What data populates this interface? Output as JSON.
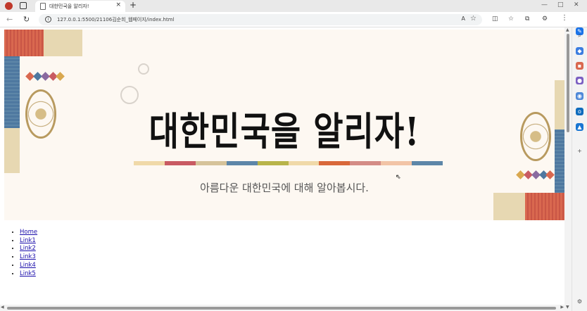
{
  "browser": {
    "tab_title": "대한민국을 알리자!",
    "tab_close": "×",
    "new_tab": "+",
    "url": "127.0.0.1:5500/21106김순희_웹페이지/index.html",
    "minimize": "—",
    "maximize": "□",
    "close": "✕",
    "more": "⋮"
  },
  "banner": {
    "title": "대한민국을 알리자!",
    "subtitle": "아름다운 대한민국에 대해 알아봅시다.",
    "stripe_colors": [
      "#f0d9a8",
      "#c95b63",
      "#d6c39a",
      "#5d86a8",
      "#b8b44a",
      "#f0d9a8",
      "#d9683a",
      "#d48c86",
      "#f2c4a6",
      "#5d86a8"
    ],
    "accent_colors": {
      "red": "#d9684f",
      "blue": "#4e78a0",
      "beige": "#e7d8b2",
      "gold": "#b89a5f"
    }
  },
  "nav": {
    "links": [
      "Home",
      "Link1",
      "Link2",
      "Link3",
      "Link4",
      "Link5"
    ]
  }
}
